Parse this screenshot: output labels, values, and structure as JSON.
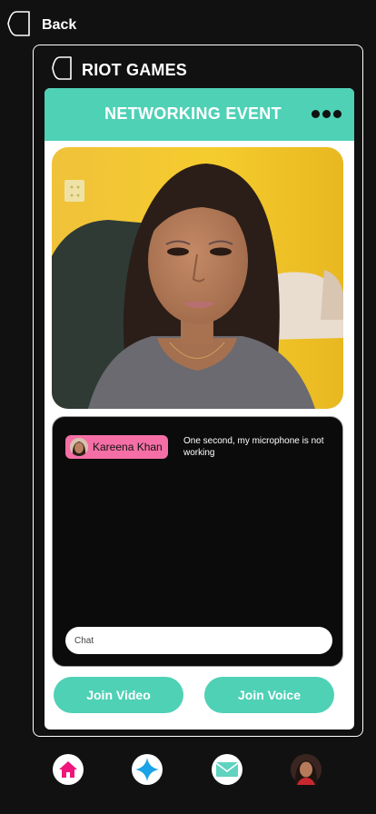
{
  "nav_top": {
    "back_label": "Back"
  },
  "group": {
    "name": "RIOT GAMES"
  },
  "event": {
    "title": "NETWORKING EVENT"
  },
  "chat": {
    "messages": [
      {
        "author": "Kareena Khan",
        "text": "One second, my microphone is not working"
      }
    ],
    "input_placeholder": "Chat"
  },
  "actions": {
    "join_video": "Join Video",
    "join_voice": "Join Voice"
  },
  "colors": {
    "accent": "#4fd1b6",
    "author_chip": "#f56fa6",
    "home_icon": "#f0157a",
    "explore_icon": "#1aa3e6",
    "mail_icon": "#5fd3bf"
  },
  "bottom_nav": [
    "home-icon",
    "explore-star-icon",
    "mail-icon",
    "profile-avatar"
  ]
}
